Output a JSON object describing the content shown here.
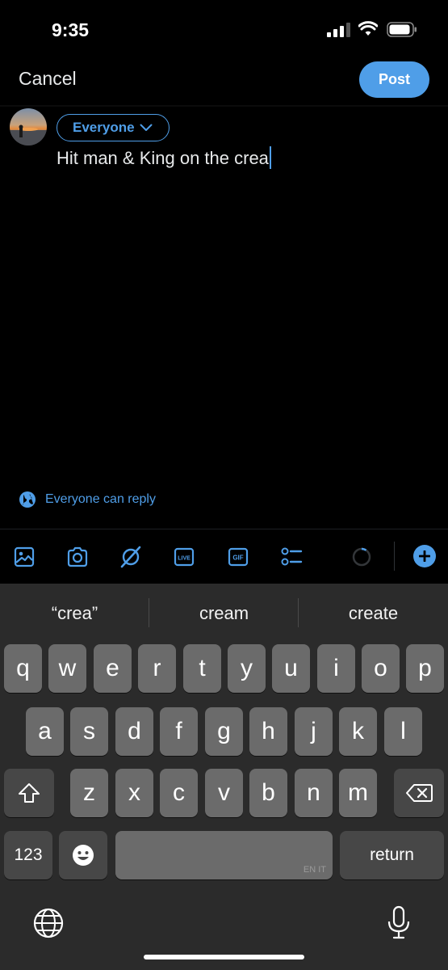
{
  "status_bar": {
    "time": "9:35"
  },
  "nav": {
    "cancel_label": "Cancel",
    "post_label": "Post"
  },
  "compose": {
    "audience_label": "Everyone",
    "text": "Hit man & King on the crea",
    "reply_setting": "Everyone can reply"
  },
  "toolbar": {
    "items": [
      "image-icon",
      "camera-icon",
      "grok-icon",
      "live-icon",
      "gif-icon",
      "poll-icon"
    ],
    "live_label": "LIVE",
    "gif_label": "GIF"
  },
  "keyboard": {
    "suggestions": [
      "“crea”",
      "cream",
      "create"
    ],
    "row1": [
      "q",
      "w",
      "e",
      "r",
      "t",
      "y",
      "u",
      "i",
      "o",
      "p"
    ],
    "row2": [
      "a",
      "s",
      "d",
      "f",
      "g",
      "h",
      "j",
      "k",
      "l"
    ],
    "row3": [
      "z",
      "x",
      "c",
      "v",
      "b",
      "n",
      "m"
    ],
    "numbers_label": "123",
    "return_label": "return",
    "space_language": "EN IT"
  },
  "colors": {
    "accent": "#4f9ee8",
    "background": "#000000",
    "keyboard": "#2b2b2b"
  }
}
